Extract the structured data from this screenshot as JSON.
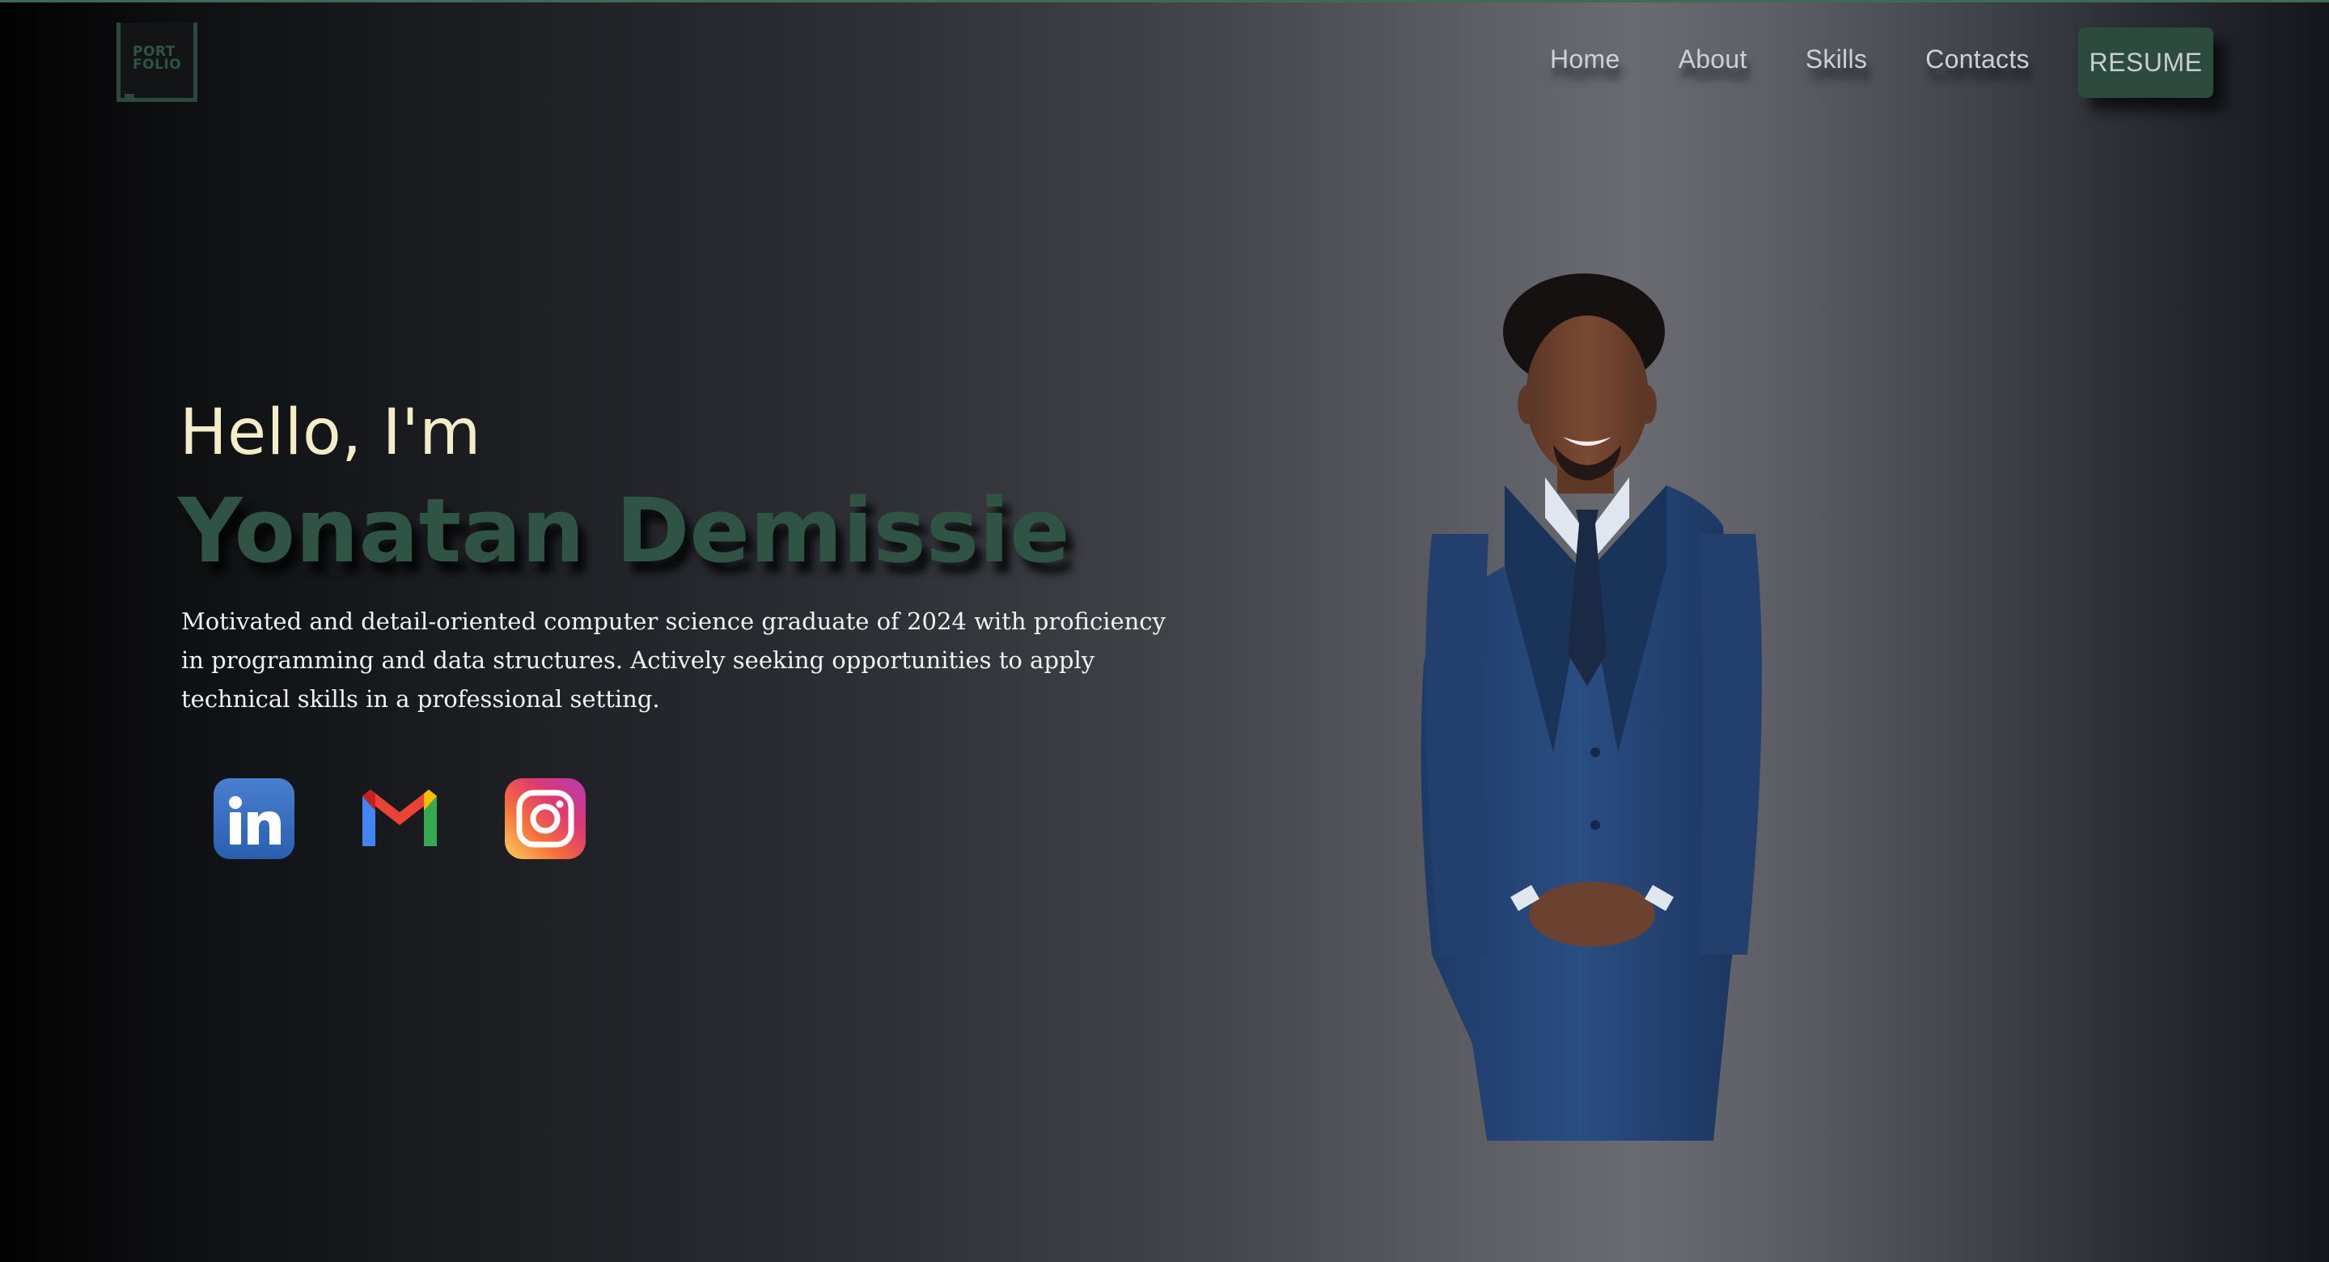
{
  "logo": {
    "line1": "PORT",
    "line2": "FOLIO"
  },
  "nav": {
    "home": "Home",
    "about": "About",
    "skills": "Skills",
    "contacts": "Contacts",
    "resume": "RESUME"
  },
  "hero": {
    "greeting": "Hello, I'm",
    "name": "Yonatan Demissie",
    "description": "Motivated and detail-oriented computer science graduate of 2024 with proficiency in programming and data structures. Actively seeking opportunities to apply technical skills in a professional setting."
  },
  "social": [
    {
      "icon": "linkedin-icon"
    },
    {
      "icon": "gmail-icon"
    },
    {
      "icon": "instagram-icon"
    }
  ],
  "colors": {
    "accent_green": "#2f5446",
    "greeting_cream": "#f3ecc8",
    "nav_text": "#cdd0d6"
  }
}
